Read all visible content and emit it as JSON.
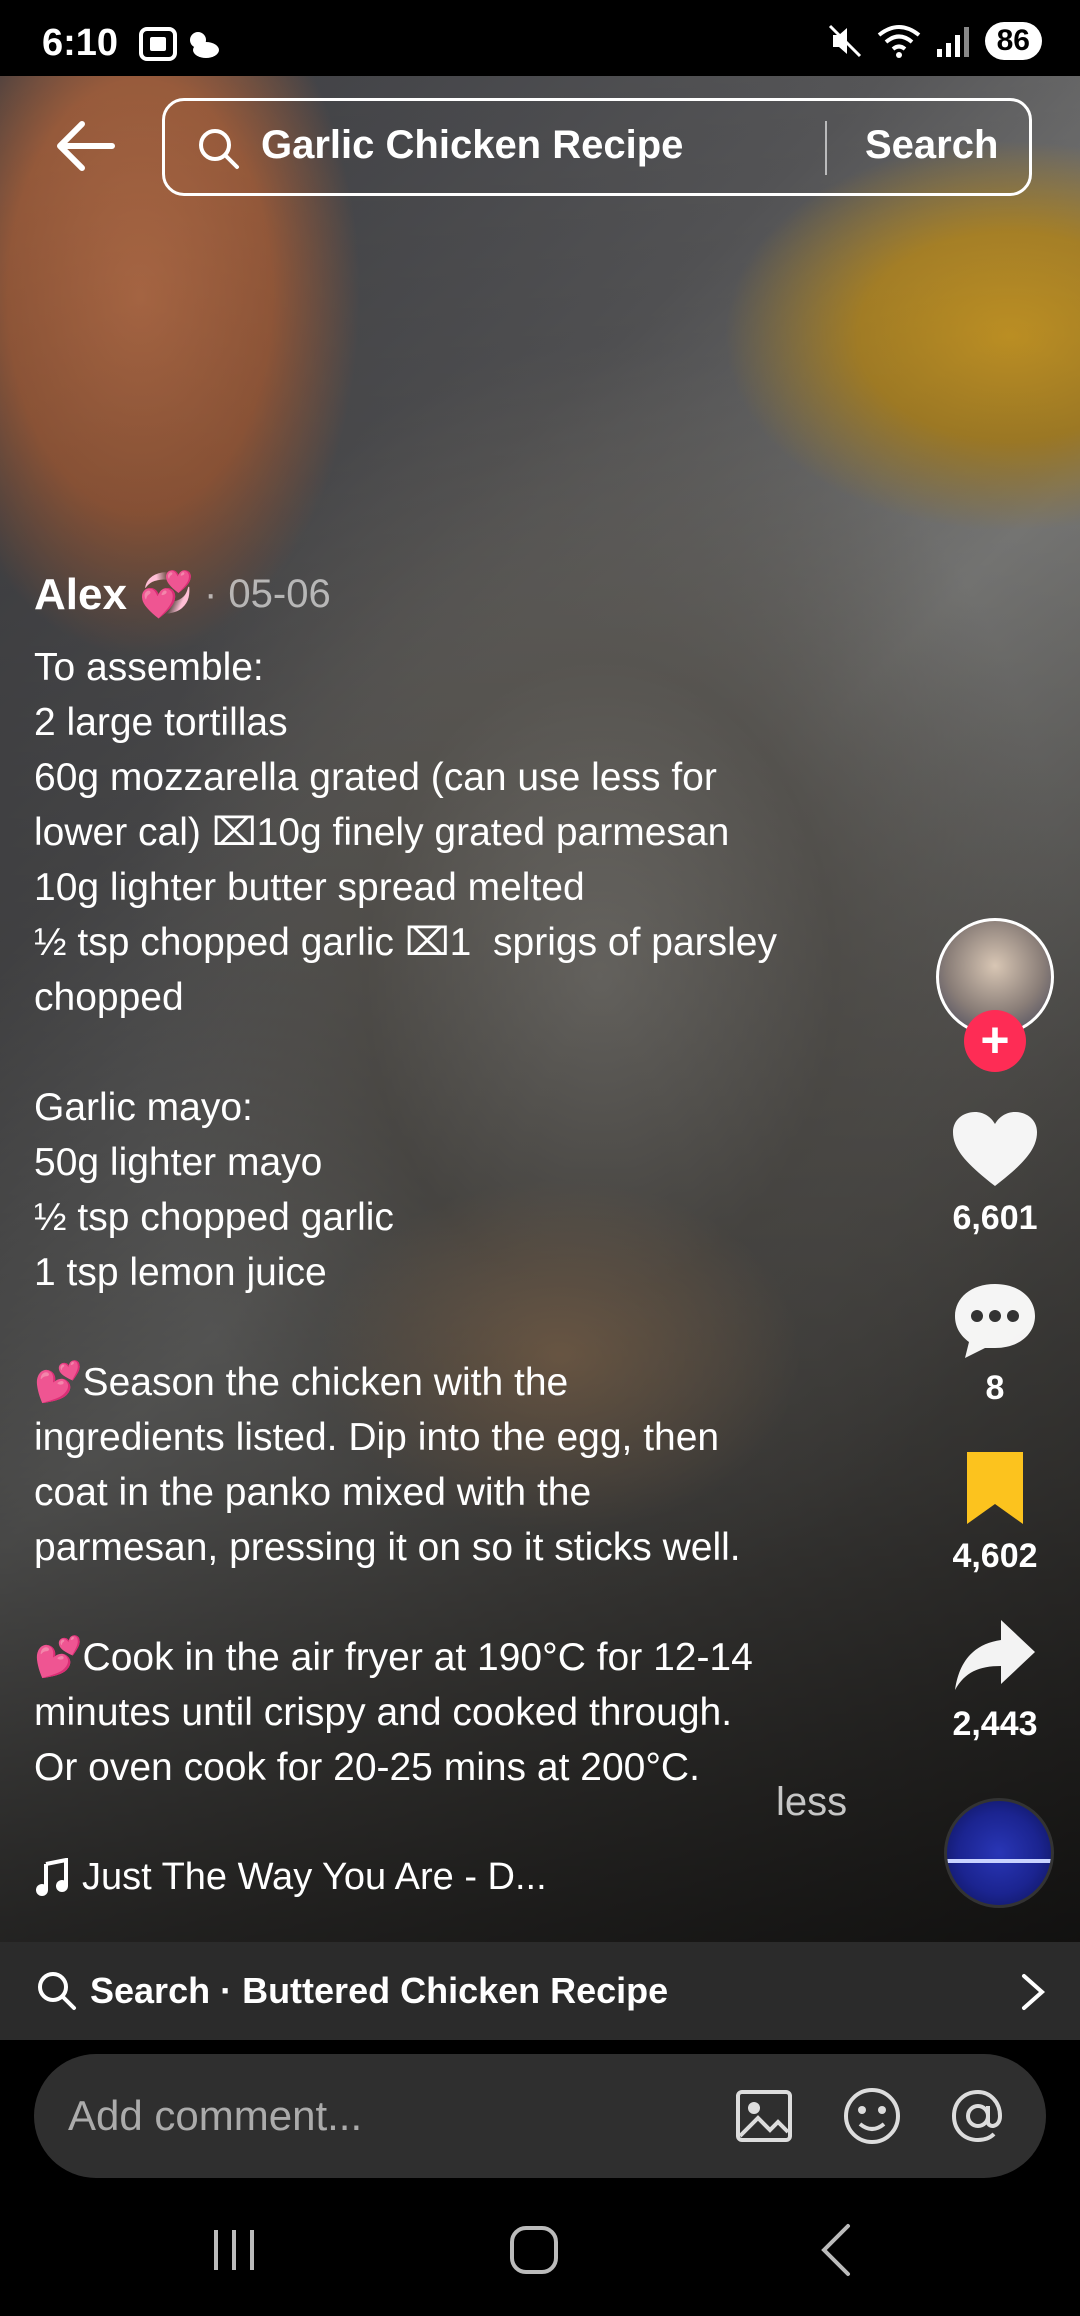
{
  "status_bar": {
    "time": "6:10",
    "battery": "86",
    "icons": [
      "screenshot-icon",
      "weather-icon",
      "mute-icon",
      "wifi-icon",
      "signal-icon"
    ]
  },
  "top_bar": {
    "back_icon": "arrow-left-icon",
    "search_query": "Garlic Chicken Recipe",
    "search_button": "Search"
  },
  "post": {
    "author": "Alex 💞",
    "date": "· 05-06",
    "caption_lines": [
      "To assemble:",
      "2 large tortillas",
      "60g mozzarella grated (can use less for",
      "lower cal) ⌧10g finely grated parmesan",
      "10g lighter butter spread melted",
      "½ tsp chopped garlic ⌧1  sprigs of parsley",
      "chopped",
      "",
      "Garlic mayo:",
      "50g lighter mayo",
      "½ tsp chopped garlic",
      "1 tsp lemon juice",
      "",
      "💕Season the chicken with the",
      "ingredients listed. Dip into the egg, then",
      "coat in the panko mixed with the",
      "parmesan, pressing it on so it sticks well.",
      "",
      "💕Cook in the air fryer at 190°C for 12-14",
      "minutes until crispy and cooked through.",
      "Or oven cook for 20-25 mins at 200°C."
    ],
    "less_label": "less",
    "music": "Just The Way You Are - D..."
  },
  "actions": {
    "likes": "6,601",
    "comments": "8",
    "saves": "4,602",
    "shares": "2,443",
    "follow_plus": "+"
  },
  "suggestion": {
    "text": "Search · Buttered Chicken Recipe"
  },
  "comment_bar": {
    "placeholder": "Add comment..."
  },
  "colors": {
    "accent_red": "#fe2c55",
    "save_yellow": "#fcc31e"
  }
}
